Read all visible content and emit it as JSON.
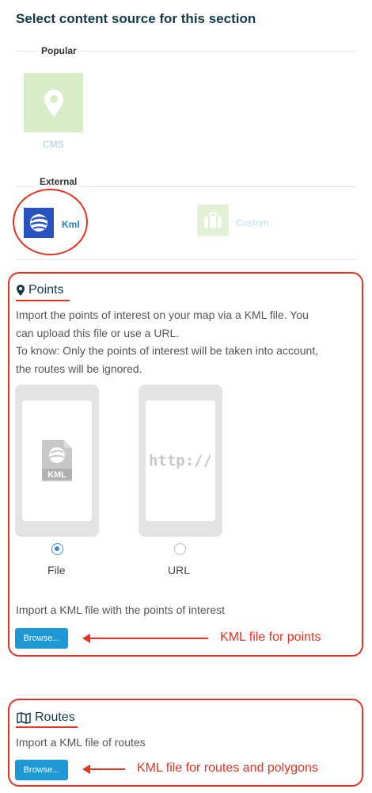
{
  "page": {
    "title": "Select content source for this section"
  },
  "popular": {
    "label": "Popular",
    "cms": {
      "label": "CMS"
    }
  },
  "external": {
    "label": "External",
    "kml": {
      "label": "Kml"
    },
    "custom": {
      "label": "Custom"
    }
  },
  "points": {
    "heading": "Points",
    "desc_line1": "Import the points of interest on your map via a KML file. You",
    "desc_line2": "can upload this file or use a URL.",
    "desc_line3": "To know: Only the points of interest will be taken into account,",
    "desc_line4": "the routes will be ignored.",
    "file_option": {
      "label": "File",
      "icon_text": "KML",
      "checked": true
    },
    "url_option": {
      "label": "URL",
      "screen_text": "http://",
      "checked": false
    },
    "import_text": "Import a KML file with the points of interest",
    "browse_label": "Browse...",
    "annotation": "KML file for points"
  },
  "routes": {
    "heading": "Routes",
    "import_text": "Import a KML file of routes",
    "browse_label": "Browse...",
    "annotation": "KML file for routes and polygons"
  },
  "colors": {
    "accent_red": "#e53323",
    "title_navy": "#123a4c",
    "button_blue": "#1e97d4",
    "kml_blue": "#2853bf",
    "cms_green": "#d6ecc7"
  }
}
